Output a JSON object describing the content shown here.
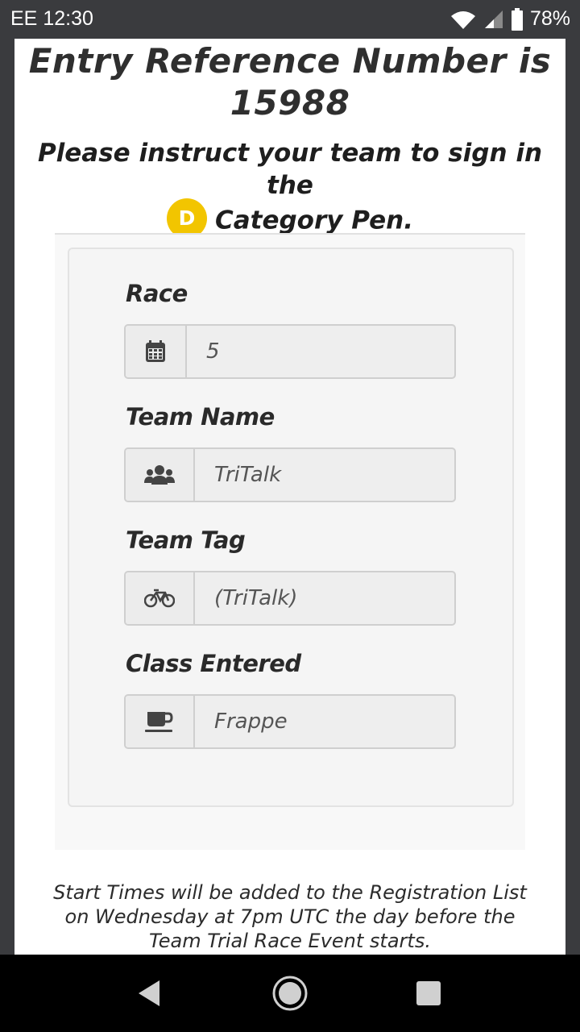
{
  "status_bar": {
    "carrier": "EE",
    "time": "12:30",
    "battery": "78%",
    "icons": [
      "wifi-icon",
      "signal-icon",
      "battery-icon"
    ]
  },
  "entry": {
    "heading": "Entry Reference Number is 15988",
    "instruction_prefix": "Please instruct your team to sign in the",
    "category_badge": "D",
    "instruction_suffix": "Category Pen.",
    "badge_color": "#f2c500"
  },
  "form": {
    "race": {
      "label": "Race",
      "value": "5",
      "icon": "calendar-icon"
    },
    "team_name": {
      "label": "Team Name",
      "value": "TriTalk",
      "icon": "users-icon"
    },
    "team_tag": {
      "label": "Team Tag",
      "value": "(TriTalk)",
      "icon": "bicycle-icon"
    },
    "class_entered": {
      "label": "Class Entered",
      "value": "Frappe",
      "icon": "coffee-icon"
    }
  },
  "footnote": "Start Times will be added to the Registration List on Wednesday at 7pm UTC the day before the Team Trial Race Event starts.",
  "nav": {
    "buttons": [
      "back-icon",
      "home-icon",
      "recents-icon"
    ]
  }
}
